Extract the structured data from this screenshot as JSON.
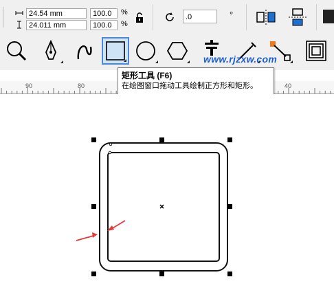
{
  "property_bar": {
    "width_value": "24.54 mm",
    "height_value": "24.011 mm",
    "scale_x_value": "100.0",
    "scale_y_value": "100.0",
    "percent_symbol": "%",
    "rotation_value": ".0",
    "degree_symbol": "°"
  },
  "toolbox": {
    "tools": [
      "zoom-tool",
      "pen-tool",
      "freehand-tool",
      "rectangle-tool",
      "ellipse-tool",
      "polygon-tool",
      "text-tool",
      "dimension-tool",
      "connector-tool",
      "contour-tool"
    ],
    "active_tool": "rectangle-tool"
  },
  "tooltip": {
    "title": "矩形工具 (F6)",
    "description": "在绘图窗口拖动工具绘制正方形和矩形。"
  },
  "watermark": "www.rjzxw.com",
  "ruler": {
    "labels": [
      "90",
      "80",
      "40"
    ]
  },
  "colors": {
    "active_tool_border": "#4b89d8",
    "active_tool_fill": "#cfe3f7",
    "arrow_red": "#e63a3a",
    "connector_orange": "#f07a1a",
    "watermark_blue": "#1e5fd0"
  }
}
